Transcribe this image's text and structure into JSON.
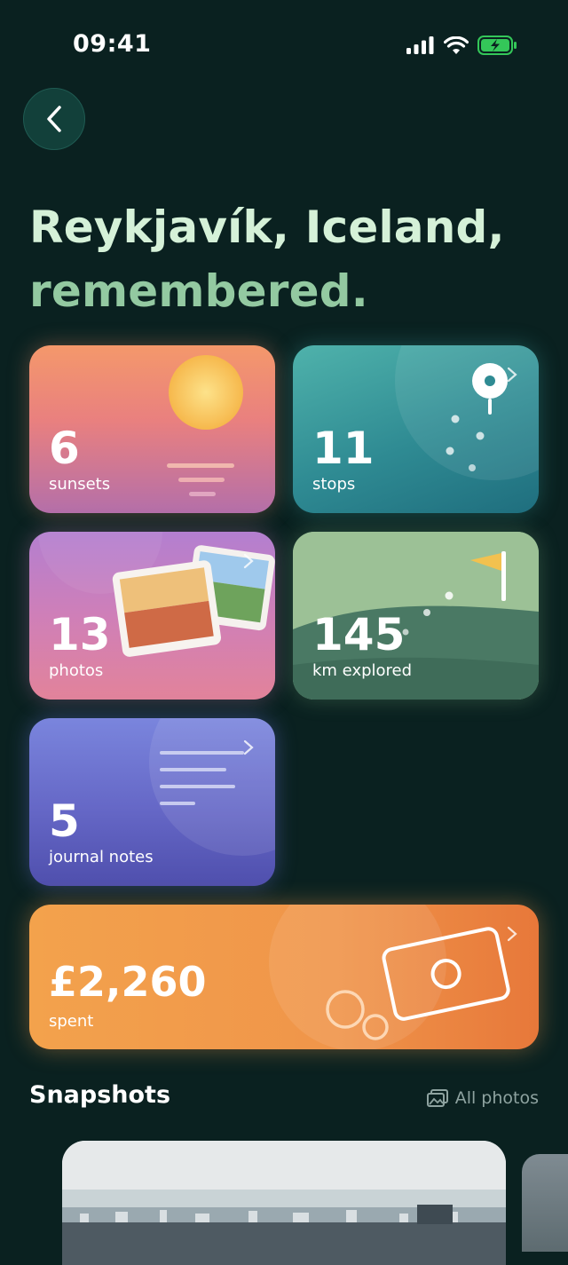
{
  "status_bar": {
    "time": "09:41"
  },
  "headline": {
    "line1": "Reykjavík, Iceland,",
    "line2": "remembered."
  },
  "cards": {
    "sunsets": {
      "value": "6",
      "label": "sunsets"
    },
    "stops": {
      "value": "11",
      "label": "stops"
    },
    "photos": {
      "value": "13",
      "label": "photos"
    },
    "km": {
      "value": "145",
      "label": "km explored"
    },
    "journal": {
      "value": "5",
      "label": "journal notes"
    },
    "spent": {
      "value": "£2,260",
      "label": "spent"
    }
  },
  "snapshots": {
    "title": "Snapshots",
    "all_photos_label": "All photos"
  },
  "colors": {
    "background": "#0a2120",
    "headline_primary": "#d5f1d8",
    "headline_accent": "#93c9a1",
    "battery_green": "#34c759"
  }
}
